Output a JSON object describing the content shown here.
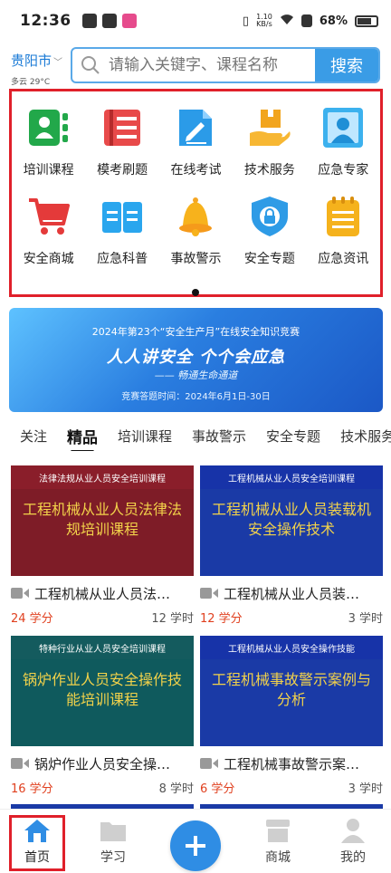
{
  "status_bar": {
    "time": "12:36",
    "net_speed_value": "1.10",
    "net_speed_unit": "KB/s",
    "battery": "68%"
  },
  "header": {
    "city": "贵阳市",
    "weather": "多云 29°C",
    "search_placeholder": "请输入关键字、课程名称",
    "search_button": "搜索"
  },
  "grid": {
    "items": [
      {
        "label": "培训课程",
        "icon": "training-course-icon"
      },
      {
        "label": "模考刷题",
        "icon": "mock-exam-icon"
      },
      {
        "label": "在线考试",
        "icon": "online-exam-icon"
      },
      {
        "label": "技术服务",
        "icon": "tech-service-icon"
      },
      {
        "label": "应急专家",
        "icon": "emergency-expert-icon"
      },
      {
        "label": "安全商城",
        "icon": "shopping-cart-icon"
      },
      {
        "label": "应急科普",
        "icon": "book-icon"
      },
      {
        "label": "事故警示",
        "icon": "bell-icon"
      },
      {
        "label": "安全专题",
        "icon": "shield-icon"
      },
      {
        "label": "应急资讯",
        "icon": "news-icon"
      }
    ]
  },
  "banner": {
    "line1": "2024年第23个“安全生产月”在线安全知识竞赛",
    "line2": "人人讲安全    个个会应急",
    "line3": "—— 畅通生命通道",
    "line4": "竞赛答题时间：2024年6月1日-30日"
  },
  "tabs": [
    "关注",
    "精品",
    "培训课程",
    "事故警示",
    "安全专题",
    "技术服务"
  ],
  "active_tab": "精品",
  "courses": [
    {
      "tag": "法律法规从业人员安全培训课程",
      "thumb_title": "工程机械从业人员法律法规培训课程",
      "title": "工程机械从业人员法…",
      "credit": "24 学分",
      "hours": "12 学时",
      "tag_color": "#8a1e2a",
      "bg": "#7e1c27"
    },
    {
      "tag": "工程机械从业人员安全培训课程",
      "thumb_title": "工程机械从业人员装载机安全操作技术",
      "title": "工程机械从业人员装…",
      "credit": "12 学分",
      "hours": "3 学时",
      "tag_color": "#1733a8",
      "bg": "#1a3aa6"
    },
    {
      "tag": "特种行业从业人员安全培训课程",
      "thumb_title": "锅炉作业人员安全操作技能培训课程",
      "title": "锅炉作业人员安全操…",
      "credit": "16 学分",
      "hours": "8 学时",
      "tag_color": "#145b5e",
      "bg": "#0f5a5d"
    },
    {
      "tag": "工程机械从业人员安全操作技能",
      "thumb_title": "工程机械事故警示案例与分析",
      "title": "工程机械事故警示案…",
      "credit": "6 学分",
      "hours": "3 学时",
      "tag_color": "#1733a8",
      "bg": "#1a3aa6"
    }
  ],
  "bottom_nav": {
    "home": "首页",
    "study": "学习",
    "mall": "商城",
    "mine": "我的"
  }
}
